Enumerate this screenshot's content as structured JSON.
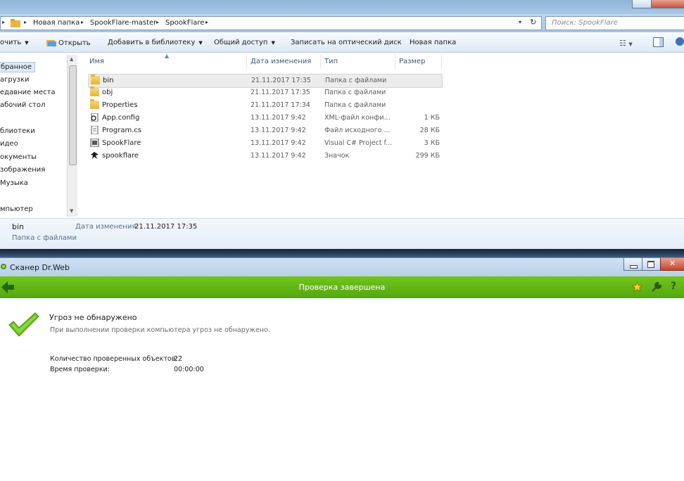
{
  "explorer": {
    "breadcrumb": [
      "Новая папка",
      "SpookFlare-master",
      "SpookFlare"
    ],
    "search_placeholder": "Поиск: SpookFlare",
    "toolbar": {
      "organize": "очить",
      "open": "Открыть",
      "add_to_library": "Добавить в библиотеку",
      "share": "Общий доступ",
      "burn": "Записать на оптический диск",
      "new_folder": "Новая папка"
    },
    "nav": [
      "бранное",
      "агрузки",
      "едавние места",
      "абочий стол",
      "блиотеки",
      "идео",
      "окументы",
      "зображения",
      "Музыка",
      "мпьютер"
    ],
    "columns": {
      "name": "Имя",
      "date": "Дата изменения",
      "type": "Тип",
      "size": "Размер"
    },
    "files": [
      {
        "name": "bin",
        "date": "21.11.2017 17:35",
        "type": "Папка с файлами",
        "size": "",
        "icon": "folder-icon",
        "selected": true
      },
      {
        "name": "obj",
        "date": "21.11.2017 17:35",
        "type": "Папка с файлами",
        "size": "",
        "icon": "folder-icon"
      },
      {
        "name": "Properties",
        "date": "21.11.2017 17:34",
        "type": "Папка с файлами",
        "size": "",
        "icon": "folder-icon"
      },
      {
        "name": "App.config",
        "date": "13.11.2017 9:42",
        "type": "XML-файл конфи...",
        "size": "1 КБ",
        "icon": "config-file-icon"
      },
      {
        "name": "Program.cs",
        "date": "13.11.2017 9:42",
        "type": "Файл исходного ...",
        "size": "28 КБ",
        "icon": "cs-file-icon"
      },
      {
        "name": "SpookFlare",
        "date": "13.11.2017 9:42",
        "type": "Visual C# Project f...",
        "size": "3 КБ",
        "icon": "csproj-file-icon"
      },
      {
        "name": "spookflare",
        "date": "13.11.2017 9:42",
        "type": "Значок",
        "size": "299 КБ",
        "icon": "ico-file-icon"
      }
    ],
    "details": {
      "name": "bin",
      "type": "Папка с файлами",
      "modified_label": "Дата изменения:",
      "modified_value": "21.11.2017 17:35"
    }
  },
  "drweb": {
    "window_title": "Сканер Dr.Web",
    "header_title": "Проверка завершена",
    "result_title": "Угроз не обнаружено",
    "result_subtitle": "При выполнении проверки компьютера угроз не обнаружено.",
    "stats": [
      {
        "label": "Количество проверенных объектов:",
        "value": "22"
      },
      {
        "label": "Время проверки:",
        "value": "00:00:00"
      }
    ]
  },
  "colors": {
    "drweb_green": "#5fb314",
    "explorer_frame": "#a9c8e4",
    "check_green": "#6cc41a"
  }
}
